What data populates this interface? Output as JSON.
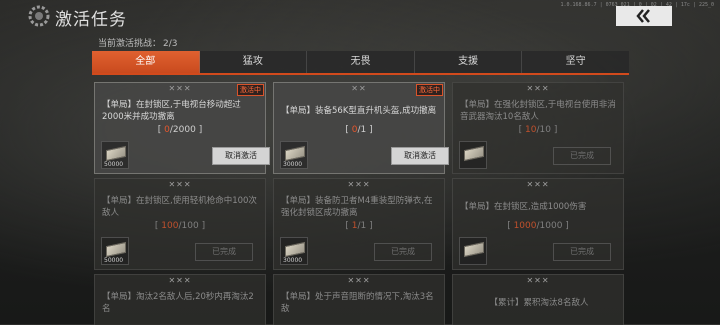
{
  "header": {
    "title": "激活任务",
    "debug_text": "1.0.168.86.7 | 0763_021 | 0 | 02 | 42 | 17c | 225_0"
  },
  "progress": {
    "label": "当前激活挑战：",
    "value": "2/3"
  },
  "tabs": [
    {
      "label": "全部",
      "active": true
    },
    {
      "label": "猛攻",
      "active": false
    },
    {
      "label": "无畏",
      "active": false
    },
    {
      "label": "支援",
      "active": false
    },
    {
      "label": "坚守",
      "active": false
    }
  ],
  "cards": [
    {
      "rank": "✕✕✕",
      "badge": "激活中",
      "desc": "【单局】在封锁区,于电视台移动超过2000米并成功撤离",
      "current": "0",
      "target": "/2000",
      "reward": "50000",
      "action": "取消激活"
    },
    {
      "rank": "✕✕",
      "badge": "激活中",
      "desc": "【单局】装备56K型直升机头盔,成功撤离",
      "current": "0",
      "target": "/1",
      "reward": "30000",
      "action": "取消激活"
    },
    {
      "rank": "✕✕✕",
      "desc": "【单局】在强化封锁区,于电视台使用非消音武器淘汰10名敌人",
      "current": "10",
      "target": "/10",
      "action": "已完成"
    },
    {
      "rank": "✕✕✕",
      "desc": "【单局】在封锁区,使用轻机枪命中100次敌人",
      "current": "100",
      "target": "/100",
      "reward": "50000",
      "action": "已完成"
    },
    {
      "rank": "✕✕✕",
      "desc": "【单局】装备防卫者M4重装型防弹衣,在强化封锁区成功撤离",
      "current": "1",
      "target": "/1",
      "reward": "30000",
      "action": "已完成"
    },
    {
      "rank": "✕✕✕",
      "desc": "【单局】在封锁区,造成1000伤害",
      "current": "1000",
      "target": "/1000",
      "action": "已完成"
    },
    {
      "rank": "✕✕✕",
      "desc": "【单局】淘汰2名敌人后,20秒内再淘汰2名"
    },
    {
      "rank": "✕✕✕",
      "desc": "【单局】处于声音阻断的情况下,淘汰3名敌"
    },
    {
      "rank": "✕✕✕",
      "desc": "【累计】累积淘汰8名敌人"
    }
  ],
  "colors": {
    "accent": "#d24a1c",
    "badge": "#ff6a3a"
  },
  "icons": {
    "header": "gear-icon",
    "back": "chevron-left-icon",
    "reward": "ticket-icon"
  }
}
